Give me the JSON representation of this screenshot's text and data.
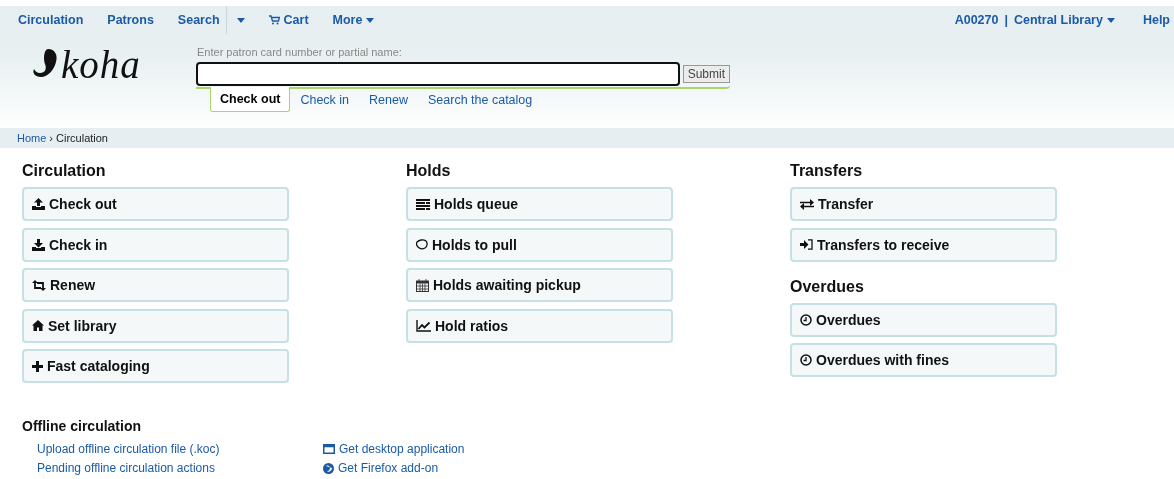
{
  "top_nav": {
    "left": [
      {
        "label": "Circulation",
        "kind": "link"
      },
      {
        "label": "Patrons",
        "kind": "link"
      },
      {
        "label": "Search",
        "kind": "link"
      },
      {
        "kind": "caret"
      },
      {
        "label": "Cart",
        "kind": "cart"
      },
      {
        "label": "More",
        "kind": "menu"
      }
    ],
    "right": [
      {
        "label": "A00270",
        "kind": "link"
      },
      {
        "label": "|",
        "kind": "separator"
      },
      {
        "label": "Central Library",
        "kind": "menu"
      },
      {
        "label": "Help",
        "kind": "link"
      }
    ]
  },
  "logo": {
    "text": "koha"
  },
  "patron_search": {
    "label": "Enter patron card number or partial name:",
    "submit": "Submit",
    "tabs": [
      {
        "label": "Check out",
        "selected": true
      },
      {
        "label": "Check in",
        "selected": false
      },
      {
        "label": "Renew",
        "selected": false
      },
      {
        "label": "Search the catalog",
        "selected": false
      }
    ]
  },
  "breadcrumb": [
    {
      "label": "Home",
      "kind": "link"
    },
    {
      "label": "›",
      "kind": "separator"
    },
    {
      "label": "Circulation",
      "kind": "current"
    }
  ],
  "columns": [
    {
      "sections": [
        {
          "title": "Circulation",
          "buttons": [
            "Check out",
            "Check in",
            "Renew",
            "Set library",
            "Fast cataloging"
          ]
        }
      ]
    },
    {
      "sections": [
        {
          "title": "Holds",
          "buttons": [
            "Holds queue",
            "Holds to pull",
            "Holds awaiting pickup",
            "Hold ratios"
          ]
        }
      ]
    },
    {
      "sections": [
        {
          "title": "Transfers",
          "buttons": [
            "Transfer",
            "Transfers to receive"
          ]
        },
        {
          "title": "Overdues",
          "buttons": [
            "Overdues",
            "Overdues with fines"
          ]
        }
      ]
    }
  ],
  "offline": {
    "title": "Offline circulation",
    "left_links": [
      "Upload offline circulation file (.koc)",
      "Pending offline circulation actions"
    ],
    "right_links": [
      "Get desktop application",
      "Get Firefox add-on"
    ]
  }
}
